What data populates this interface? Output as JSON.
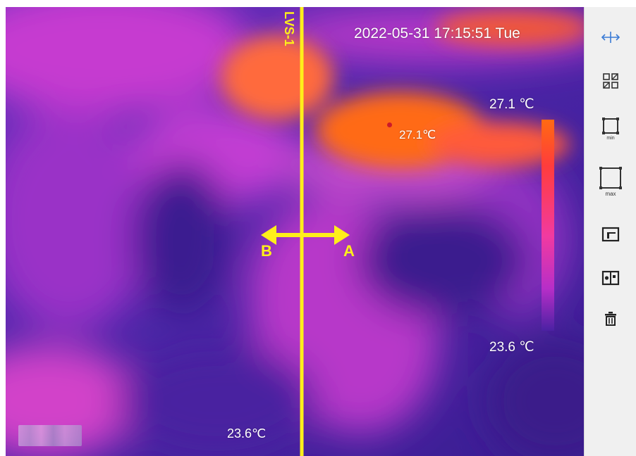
{
  "overlay": {
    "timestamp": "2022-05-31 17:15:51 Tue",
    "line_name": "LVS-1",
    "arrow_left_label": "B",
    "arrow_right_label": "A",
    "max_temp_label": "27.1 ℃",
    "min_temp_label": "23.6 ℃",
    "hot_spot_label": "27.1℃",
    "cold_spot_label": "23.6℃"
  },
  "colors": {
    "measure_line": "#ffef1a",
    "scale_top": "#ff6a12",
    "scale_bottom": "#4b21a3"
  },
  "toolbar": {
    "items": [
      {
        "icon": "move-icon",
        "sub": ""
      },
      {
        "icon": "grid-icon",
        "sub": ""
      },
      {
        "icon": "min-box-icon",
        "sub": "min"
      },
      {
        "icon": "max-box-icon",
        "sub": "max"
      },
      {
        "icon": "panel-icon",
        "sub": ""
      },
      {
        "icon": "panel-dot-icon",
        "sub": ""
      },
      {
        "icon": "trash-icon",
        "sub": ""
      }
    ]
  }
}
